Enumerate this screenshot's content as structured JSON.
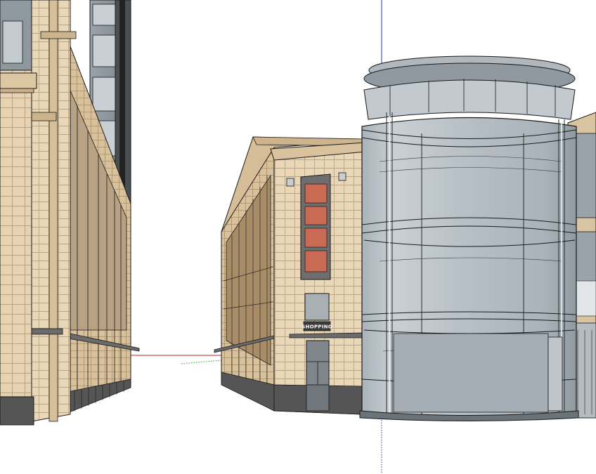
{
  "viewport": {
    "scene": "sketchup-3d-model-view"
  },
  "scene": {
    "sign_text": "SHOPPING",
    "colors": {
      "background": "#ffffff",
      "facade_stone": "#e9d6b6",
      "facade_stone_shadow": "#c9b08a",
      "facade_grid": "#b59a72",
      "base_plinth": "#5c5c5c",
      "glass": "#b7c0c6",
      "glass_dark": "#9aa5ad",
      "window_panel_red": "#c96a55",
      "window_frame": "#707070",
      "tower_grey": "#8f989e",
      "axis_red": "#d02020",
      "axis_blue": "#2030c0",
      "axis_green": "#20a020",
      "edges": "#1a1a1a"
    }
  }
}
